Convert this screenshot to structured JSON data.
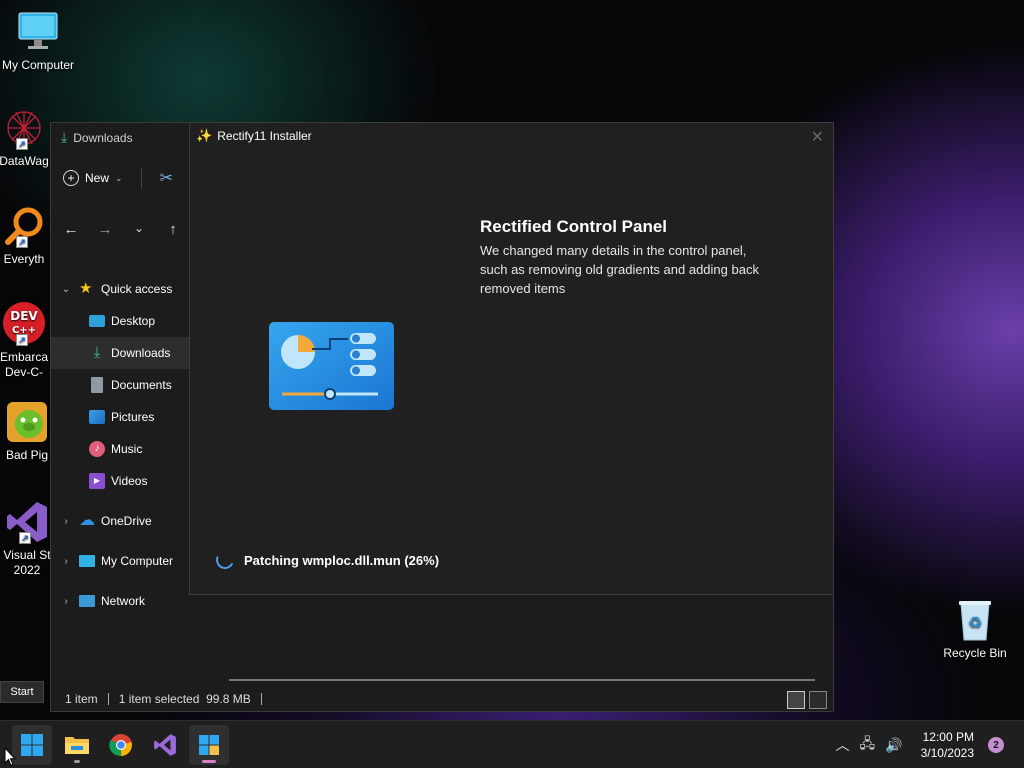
{
  "desktop": {
    "icons": [
      {
        "label": "My Computer"
      },
      {
        "label": "DataWag"
      },
      {
        "label": "Everyth"
      },
      {
        "label": "Embarca Dev-C-"
      },
      {
        "label": "Bad Pig"
      },
      {
        "label": "Visual St 2022"
      },
      {
        "label": "Recycle Bin"
      }
    ]
  },
  "explorer": {
    "title": "Downloads",
    "toolbar": {
      "new_label": "New"
    },
    "sidebar": {
      "quick_access": "Quick access",
      "items": [
        {
          "label": "Desktop"
        },
        {
          "label": "Downloads"
        },
        {
          "label": "Documents"
        },
        {
          "label": "Pictures"
        },
        {
          "label": "Music"
        },
        {
          "label": "Videos"
        }
      ],
      "onedrive": "OneDrive",
      "my_computer": "My Computer",
      "network": "Network"
    },
    "status": {
      "count": "1 item",
      "selected": "1 item selected  99.8 MB"
    }
  },
  "installer": {
    "title": "Rectify11 Installer",
    "heading": "Rectified Control Panel",
    "description": "We changed many details in the control panel, such as removing old gradients and adding back removed items",
    "progress_text": "Patching wmploc.dll.mun (26%)",
    "progress_percent": 26
  },
  "start_tooltip": "Start",
  "taskbar": {
    "time": "12:00 PM",
    "date": "3/10/2023",
    "notification_count": "2"
  },
  "colors": {
    "accent": "#4a9fe8",
    "notification_badge": "#c38fd0"
  }
}
